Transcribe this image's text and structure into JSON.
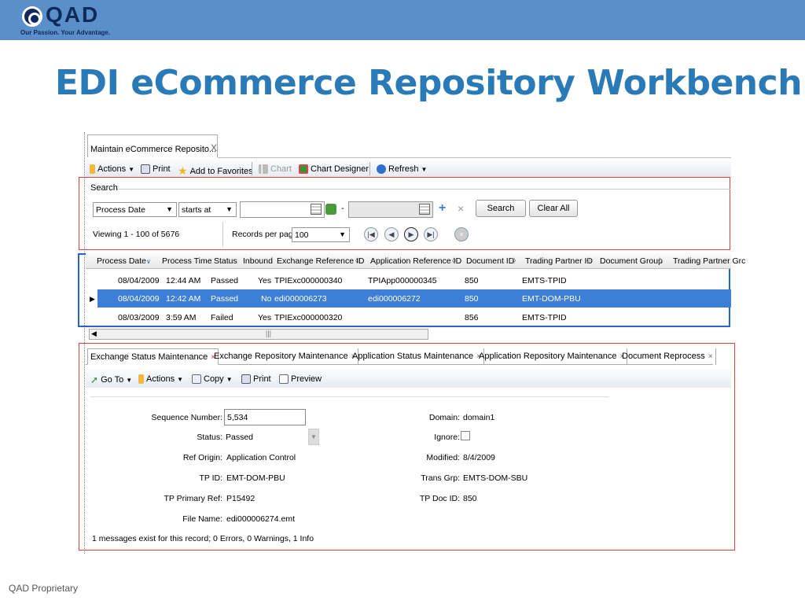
{
  "branding": {
    "logo_text": "QAD",
    "tagline": "Our Passion. Your Advantage."
  },
  "slide": {
    "title": "EDI eCommerce Repository Workbench",
    "footer": "QAD Proprietary"
  },
  "app": {
    "tab_title": "Maintain eCommerce Reposito...",
    "tab_close": "X",
    "toolbar": {
      "actions": "Actions",
      "print": "Print",
      "favorites": "Add to Favorites",
      "chart": "Chart",
      "chart_designer": "Chart Designer",
      "refresh": "Refresh"
    },
    "search": {
      "label": "Search",
      "field": "Process Date",
      "operator": "starts at",
      "dash": "-",
      "search_button": "Search",
      "clear_button": "Clear All",
      "viewing": "Viewing 1 - 100  of  5676",
      "records_label": "Records per page:",
      "records_value": "100"
    },
    "grid": {
      "columns": [
        "Process Date",
        "Process Time",
        "Status",
        "Inbound",
        "Exchange Reference ID",
        "Application Reference ID",
        "Document ID",
        "Trading Partner ID",
        "Document Group",
        "Trading Partner Grc"
      ],
      "rows": [
        {
          "date": "08/04/2009",
          "time": "12:44 AM",
          "status": "Passed",
          "inbound": "Yes",
          "exch": "TPIExc000000340",
          "appref": "TPIApp000000345",
          "doc": "850",
          "tp": "EMTS-TPID"
        },
        {
          "date": "08/04/2009",
          "time": "12:42 AM",
          "status": "Passed",
          "inbound": "No",
          "exch": "edi000006273",
          "appref": "edi000006272",
          "doc": "850",
          "tp": "EMT-DOM-PBU"
        },
        {
          "date": "08/03/2009",
          "time": "3:59 AM",
          "status": "Failed",
          "inbound": "Yes",
          "exch": "TPIExc000000320",
          "appref": "",
          "doc": "856",
          "tp": "EMTS-TPID"
        }
      ]
    },
    "detail_tabs": [
      "Exchange Status Maintenance",
      "Exchange Repository Maintenance",
      "Application Status Maintenance",
      "Application Repository Maintenance",
      "Document Reprocess"
    ],
    "tab_x": "×",
    "detail_toolbar": {
      "goto": "Go To",
      "actions": "Actions",
      "copy": "Copy",
      "print": "Print",
      "preview": "Preview"
    },
    "form": {
      "seq_label": "Sequence Number:",
      "seq_value": "5,534",
      "status_label": "Status:",
      "status_value": "Passed",
      "origin_label": "Ref Origin:",
      "origin_value": "Application Control",
      "tpid_label": "TP ID:",
      "tpid_value": "EMT-DOM-PBU",
      "tpref_label": "TP Primary Ref:",
      "tpref_value": "P15492",
      "file_label": "File Name:",
      "file_value": "edi000006274.emt",
      "domain_label": "Domain:",
      "domain_value": "domain1",
      "ignore_label": "Ignore:",
      "modified_label": "Modified:",
      "modified_value": "8/4/2009",
      "transgrp_label": "Trans Grp:",
      "transgrp_value": "EMTS-DOM-SBU",
      "tpdoc_label": "TP Doc ID:",
      "tpdoc_value": "850",
      "message": "1 messages exist for this record; 0 Errors, 0 Warnings, 1 Info"
    }
  }
}
